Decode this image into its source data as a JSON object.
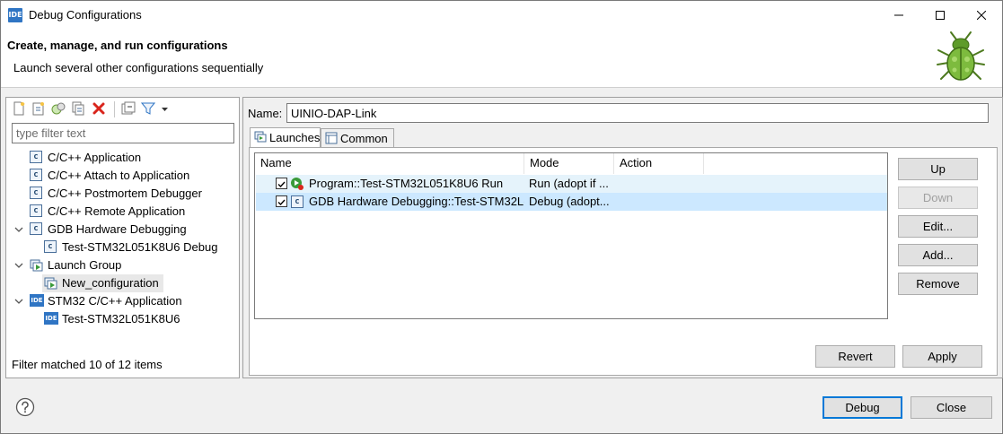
{
  "window": {
    "title": "Debug Configurations",
    "app_icon_text": "IDE",
    "controls": [
      "minimize-icon",
      "maximize-icon",
      "close-icon"
    ]
  },
  "banner": {
    "title": "Create, manage, and run configurations",
    "message": "Launch several other configurations sequentially",
    "icon": "bug-icon"
  },
  "left_panel": {
    "toolbar": [
      "new-config-icon",
      "new-prototype-icon",
      "export-icon",
      "duplicate-icon",
      "delete-icon",
      "collapse-all-icon",
      "filter-icon",
      "dropdown-arrow-icon"
    ],
    "filter_placeholder": "type filter text",
    "tree": [
      {
        "label": "C/C++ Application",
        "icon": "c-icon",
        "level": 0,
        "expander": "none"
      },
      {
        "label": "C/C++ Attach to Application",
        "icon": "c-icon",
        "level": 0,
        "expander": "none"
      },
      {
        "label": "C/C++ Postmortem Debugger",
        "icon": "c-icon",
        "level": 0,
        "expander": "none"
      },
      {
        "label": "C/C++ Remote Application",
        "icon": "c-icon",
        "level": 0,
        "expander": "none"
      },
      {
        "label": "GDB Hardware Debugging",
        "icon": "c-icon",
        "level": 0,
        "expander": "expanded"
      },
      {
        "label": "Test-STM32L051K8U6 Debug",
        "icon": "c-icon",
        "level": 1,
        "expander": "none"
      },
      {
        "label": "Launch Group",
        "icon": "launch-group-icon",
        "level": 0,
        "expander": "expanded"
      },
      {
        "label": "New_configuration",
        "icon": "launch-group-icon",
        "level": 1,
        "expander": "none",
        "selected": true
      },
      {
        "label": "STM32 C/C++ Application",
        "icon": "ide-icon",
        "level": 0,
        "expander": "expanded"
      },
      {
        "label": "Test-STM32L051K8U6",
        "icon": "ide-icon",
        "level": 1,
        "expander": "none"
      }
    ],
    "status": "Filter matched 10 of 12 items"
  },
  "right_panel": {
    "name_label": "Name:",
    "name_value": "UINIO-DAP-Link",
    "tabs": [
      {
        "label": "Launches",
        "icon": "launches-tab-icon",
        "active": true
      },
      {
        "label": "Common",
        "icon": "common-tab-icon",
        "active": false
      }
    ],
    "table": {
      "columns": [
        "Name",
        "Mode",
        "Action"
      ],
      "rows": [
        {
          "checked": true,
          "icon": "run-config-icon",
          "name": "Program::Test-STM32L051K8U6 Run",
          "mode": "Run (adopt if ...",
          "action": ""
        },
        {
          "checked": true,
          "icon": "c-icon",
          "name": "GDB Hardware Debugging::Test-STM32L(",
          "mode": "Debug (adopt...",
          "action": ""
        }
      ]
    },
    "side_buttons": [
      {
        "label": "Up",
        "enabled": true
      },
      {
        "label": "Down",
        "enabled": false
      },
      {
        "label": "Edit...",
        "enabled": true
      },
      {
        "label": "Add...",
        "enabled": true
      },
      {
        "label": "Remove",
        "enabled": true
      }
    ],
    "revert_label": "Revert",
    "apply_label": "Apply"
  },
  "footer": {
    "help_icon": "help-icon",
    "debug_label": "Debug",
    "close_label": "Close"
  },
  "colors": {
    "accent": "#0078d7",
    "selected_row": "#cce8ff",
    "alt_row": "#e5f3fb",
    "tree_selection": "#e8e8e8"
  }
}
